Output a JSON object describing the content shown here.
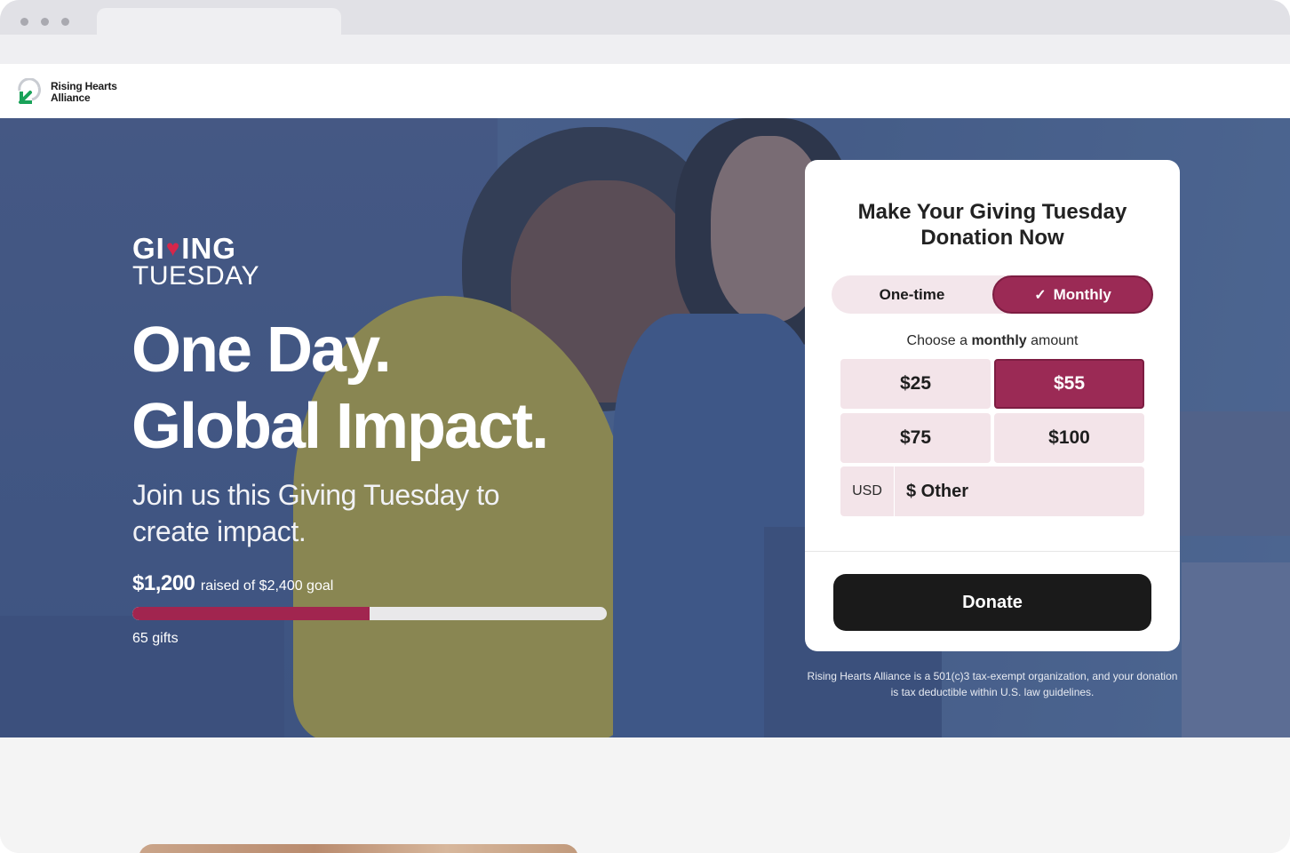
{
  "organization": {
    "name_line1": "Rising Hearts",
    "name_line2": "Alliance"
  },
  "hero": {
    "campaign_logo_line1_pre": "GI",
    "campaign_logo_line1_post": "ING",
    "campaign_logo_line2": "TUESDAY",
    "headline_line1": "One Day.",
    "headline_line2": "Global Impact.",
    "subheadline": "Join us this Giving Tuesday to create impact.",
    "raised_amount": "$1,200",
    "raised_suffix": "raised of $2,400 goal",
    "progress_fraction": 0.5,
    "gifts": "65 gifts"
  },
  "donation_form": {
    "title": "Make Your Giving Tuesday Donation Now",
    "frequency": {
      "one_time_label": "One-time",
      "monthly_label": "Monthly",
      "selected": "Monthly"
    },
    "choose_prefix": "Choose a ",
    "choose_emphasis": "monthly",
    "choose_suffix": " amount",
    "amounts": [
      "$25",
      "$55",
      "$75",
      "$100"
    ],
    "selected_amount": "$55",
    "currency": "USD",
    "other_placeholder": "$ Other",
    "donate_label": "Donate"
  },
  "disclaimer": "Rising Hearts Alliance is a 501(c)3 tax-exempt organization, and your donation is tax deductible within U.S. law guidelines.",
  "colors": {
    "accent": "#9b2a55",
    "accent_light": "#f3e4e9",
    "hero_overlay": "#4f6690",
    "donate_button": "#1a1a1a",
    "logo_green": "#1aa259"
  }
}
